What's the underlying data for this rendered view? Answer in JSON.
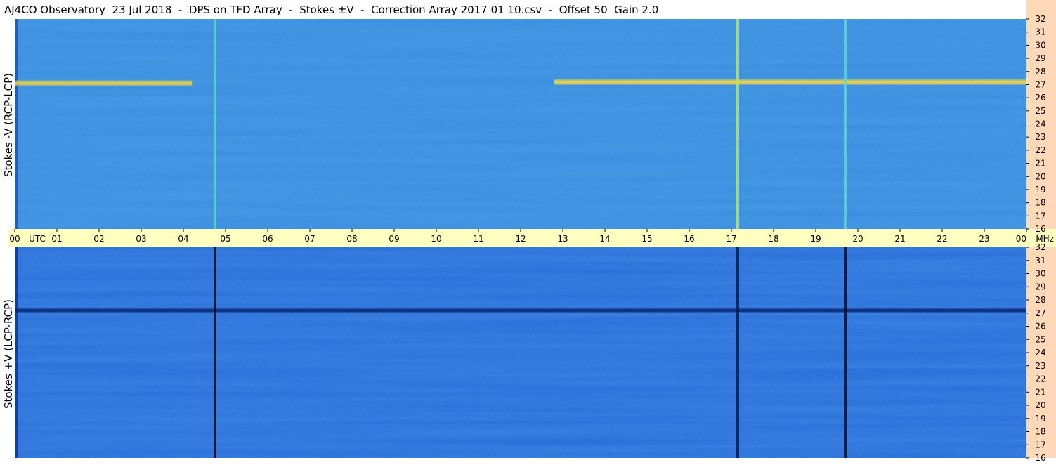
{
  "chart_data": {
    "type": "heatmap",
    "title": "AJ4CO Observatory  23 Jul 2018  -  DPS on TFD Array  -  Stokes ±V  -  Correction Array 2017 01 10.csv  -  Offset 50  Gain 2.0",
    "x_axis": {
      "unit_label": "UTC",
      "tick_labels": [
        "00",
        "01",
        "02",
        "03",
        "04",
        "05",
        "06",
        "07",
        "08",
        "09",
        "10",
        "11",
        "12",
        "13",
        "14",
        "15",
        "16",
        "17",
        "18",
        "19",
        "20",
        "21",
        "22",
        "23",
        "00"
      ],
      "range_hours": [
        0,
        24
      ]
    },
    "y_axis": {
      "unit_label": "MHz",
      "tick_labels": [
        "32",
        "31",
        "30",
        "29",
        "28",
        "27",
        "26",
        "25",
        "24",
        "23",
        "22",
        "21",
        "20",
        "19",
        "18",
        "17",
        "16"
      ],
      "range_mhz": [
        16,
        32
      ]
    },
    "panels": [
      {
        "name": "Stokes -V (RCP-LCP)",
        "base_color": "#2f86dc",
        "band_color": "#e8d24a",
        "features": [
          {
            "kind": "band",
            "mhz": 27.1,
            "from_hour": 0.0,
            "to_hour": 4.2,
            "intensity": 0.9
          },
          {
            "kind": "band",
            "mhz": 27.2,
            "from_hour": 12.8,
            "to_hour": 24.0,
            "intensity": 1.0
          },
          {
            "kind": "spike",
            "hour": 4.75,
            "color": "#5ad6c8"
          },
          {
            "kind": "spike",
            "hour": 17.15,
            "color": "#b9e36a"
          },
          {
            "kind": "spike",
            "hour": 19.7,
            "color": "#5ad6c8"
          }
        ]
      },
      {
        "name": "Stokes +V (LCP-RCP)",
        "base_color": "#1f63d6",
        "band_color": "#0b2a78",
        "features": [
          {
            "kind": "band",
            "mhz": 27.2,
            "from_hour": 0.0,
            "to_hour": 24.0,
            "intensity": 0.85
          },
          {
            "kind": "spike",
            "hour": 4.75,
            "color": "#0a0a1e"
          },
          {
            "kind": "spike",
            "hour": 17.15,
            "color": "#0a1a4a"
          },
          {
            "kind": "spike",
            "hour": 19.7,
            "color": "#0a0a1e"
          }
        ]
      }
    ],
    "colors": {
      "axis_band": "#ffffc0",
      "right_axis": "#ffd9b8"
    }
  }
}
